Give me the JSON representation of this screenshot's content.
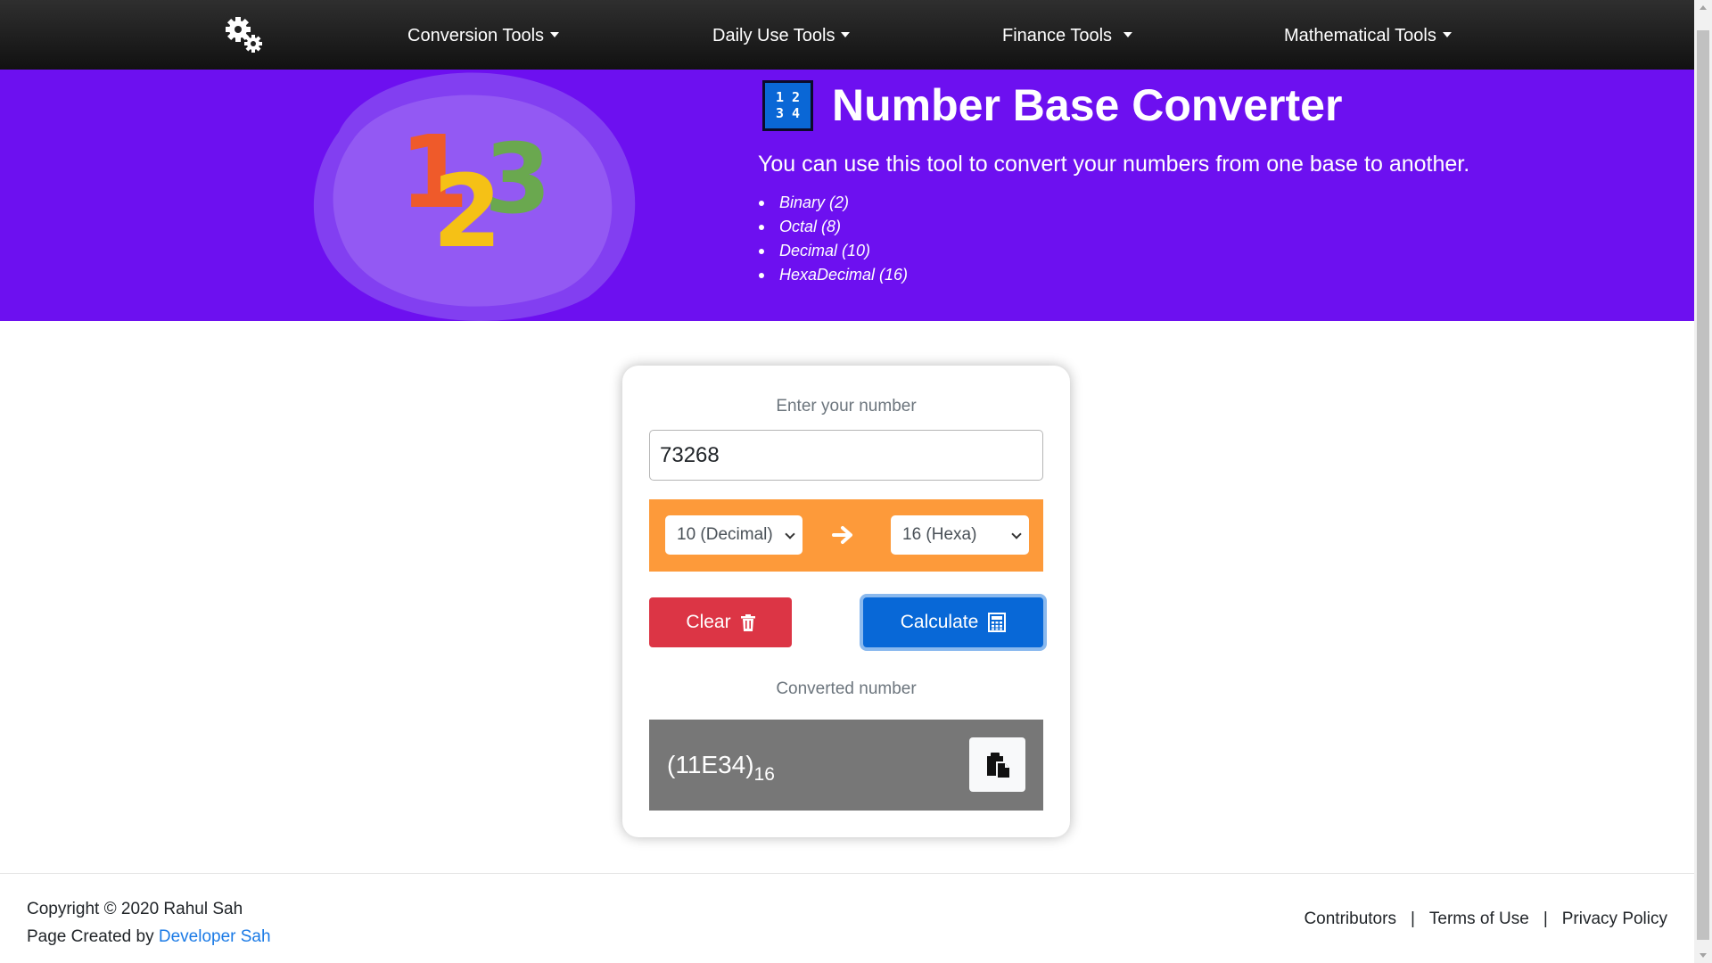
{
  "nav": {
    "logo_icon": "gears-icon",
    "items": [
      {
        "label": "Conversion Tools"
      },
      {
        "label": "Daily Use Tools"
      },
      {
        "label": "Finance Tools"
      },
      {
        "label": "Mathematical Tools"
      }
    ]
  },
  "hero": {
    "title_icon": "number-grid-icon",
    "icon_digits": [
      "1 2",
      "3 4"
    ],
    "art_digits": [
      "1",
      "2",
      "3"
    ],
    "title": "Number Base Converter",
    "description": "You can use this tool to convert your numbers from one base to another.",
    "bases": [
      "Binary (2)",
      "Octal (8)",
      "Decimal (10)",
      "HexaDecimal (16)"
    ],
    "background_color": "#6d10f0"
  },
  "converter": {
    "input_label": "Enter your number",
    "input_value": "73268",
    "from_base": "10 (Decimal)",
    "to_base": "16 (Hexa)",
    "arrow_icon": "arrow-right-icon",
    "clear_label": "Clear",
    "clear_icon": "trash-icon",
    "calculate_label": "Calculate",
    "calculate_icon": "calculator-icon",
    "output_label": "Converted number",
    "result_value": "(11E34)",
    "result_base": "16",
    "copy_icon": "clipboard-icon",
    "accent_color": "#fd9a3a",
    "clear_color": "#dc3545",
    "calculate_color": "#0868d7",
    "result_bg_color": "#777777"
  },
  "footer": {
    "copyright": "Copyright © 2020 Rahul Sah",
    "created_by_prefix": "Page Created by",
    "created_by_link": "Developer Sah",
    "links": [
      "Contributors",
      "Terms of Use",
      "Privacy Policy"
    ],
    "separator": "|"
  }
}
